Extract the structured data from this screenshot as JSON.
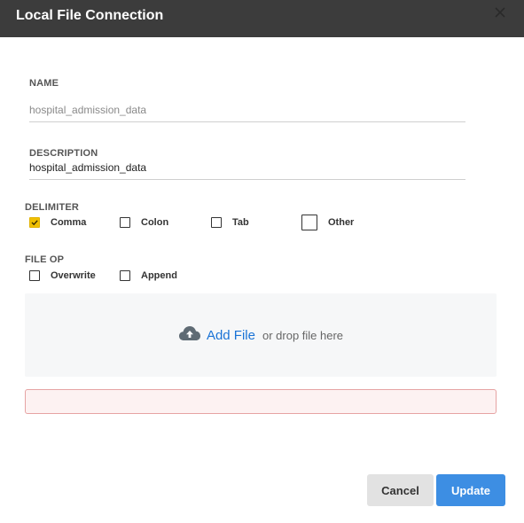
{
  "dialog": {
    "title": "Local File Connection",
    "close_icon": "close-icon"
  },
  "name": {
    "label": "NAME",
    "value": "",
    "placeholder": "hospital_admission_data"
  },
  "description": {
    "label": "DESCRIPTION",
    "value": "hospital_admission_data",
    "placeholder": ""
  },
  "delimiter": {
    "label": "DELIMITER",
    "options": [
      {
        "label": "Comma",
        "checked": true
      },
      {
        "label": "Colon",
        "checked": false
      },
      {
        "label": "Tab",
        "checked": false
      },
      {
        "label": "Other",
        "checked": false
      }
    ]
  },
  "file_op": {
    "label": "FILE OP",
    "options": [
      {
        "label": "Overwrite",
        "checked": false
      },
      {
        "label": "Append",
        "checked": false
      }
    ]
  },
  "dropzone": {
    "icon": "cloud-upload-icon",
    "add_file": "Add File",
    "drop_text": "or drop file here"
  },
  "error_message": "",
  "buttons": {
    "cancel": "Cancel",
    "update": "Update"
  },
  "colors": {
    "header_bg": "#3c3c3c",
    "checked_accent": "#f0c000",
    "link": "#1a73d6",
    "primary_button": "#3d8ee3",
    "error_border": "#e6a3a3"
  }
}
